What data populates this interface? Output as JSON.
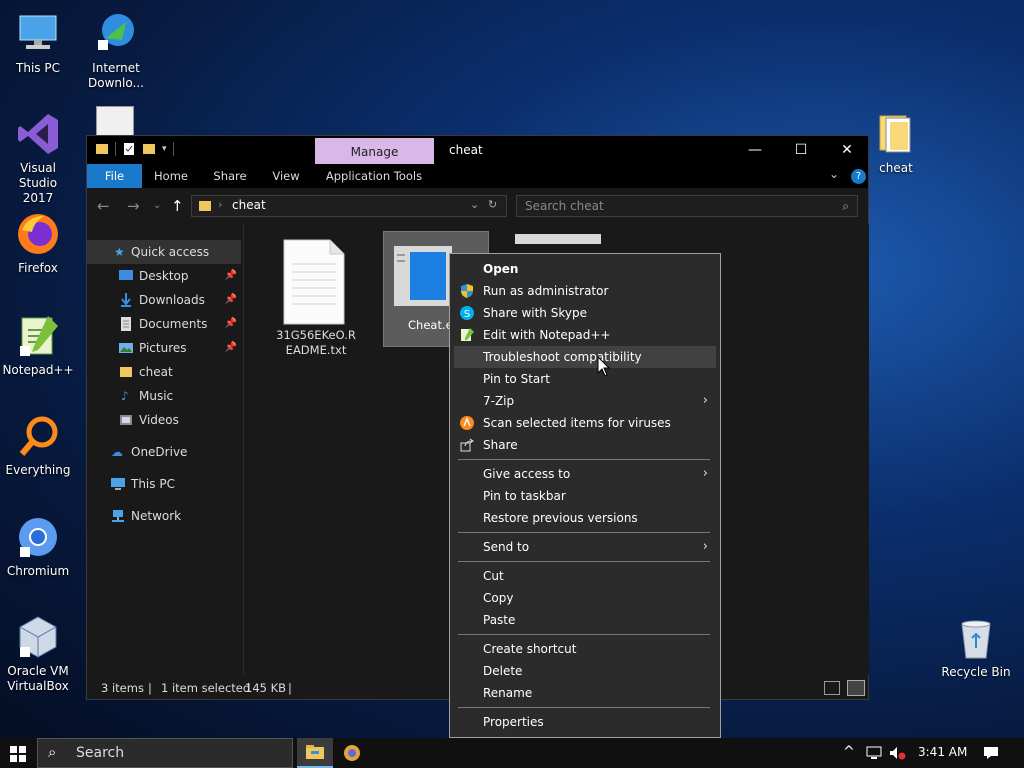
{
  "desktop": {
    "icons": [
      {
        "label": "This PC"
      },
      {
        "label": "Internet Downlo..."
      },
      {
        "label": "Visual Studio 2017"
      },
      {
        "label": "Firefox"
      },
      {
        "label": "Notepad++"
      },
      {
        "label": "Everything"
      },
      {
        "label": "Chromium"
      },
      {
        "label": "Oracle VM VirtualBox"
      },
      {
        "label": "cheat"
      },
      {
        "label": "Recycle Bin"
      }
    ]
  },
  "explorer": {
    "title": "cheat",
    "contextual_tab": "Manage",
    "ribbon_tabs": [
      "File",
      "Home",
      "Share",
      "View",
      "Application Tools"
    ],
    "address": {
      "crumb": "cheat"
    },
    "search_placeholder": "Search cheat",
    "nav": {
      "quick_access": "Quick access",
      "items": [
        "Desktop",
        "Downloads",
        "Documents",
        "Pictures",
        "cheat",
        "Music",
        "Videos"
      ],
      "onedrive": "OneDrive",
      "thispc": "This PC",
      "network": "Network"
    },
    "files": [
      {
        "name": "31G56EKeO.README.txt"
      },
      {
        "name": "Cheat.e"
      }
    ],
    "status": {
      "items": "3 items",
      "selected": "1 item selected",
      "size": "145 KB"
    }
  },
  "context_menu": {
    "items": [
      "Open",
      "Run as administrator",
      "Share with Skype",
      "Edit with Notepad++",
      "Troubleshoot compatibility",
      "Pin to Start",
      "7-Zip",
      "Scan selected items for viruses",
      "Share",
      "Give access to",
      "Pin to taskbar",
      "Restore previous versions",
      "Send to",
      "Cut",
      "Copy",
      "Paste",
      "Create shortcut",
      "Delete",
      "Rename",
      "Properties"
    ],
    "highlighted": "Troubleshoot compatibility"
  },
  "taskbar": {
    "search_placeholder": "Search",
    "time": "3:41 AM"
  },
  "colors": {
    "accent": "#1979ca",
    "manage_tab": "#d9b8e8",
    "menu_bg": "#2b2b2b"
  }
}
